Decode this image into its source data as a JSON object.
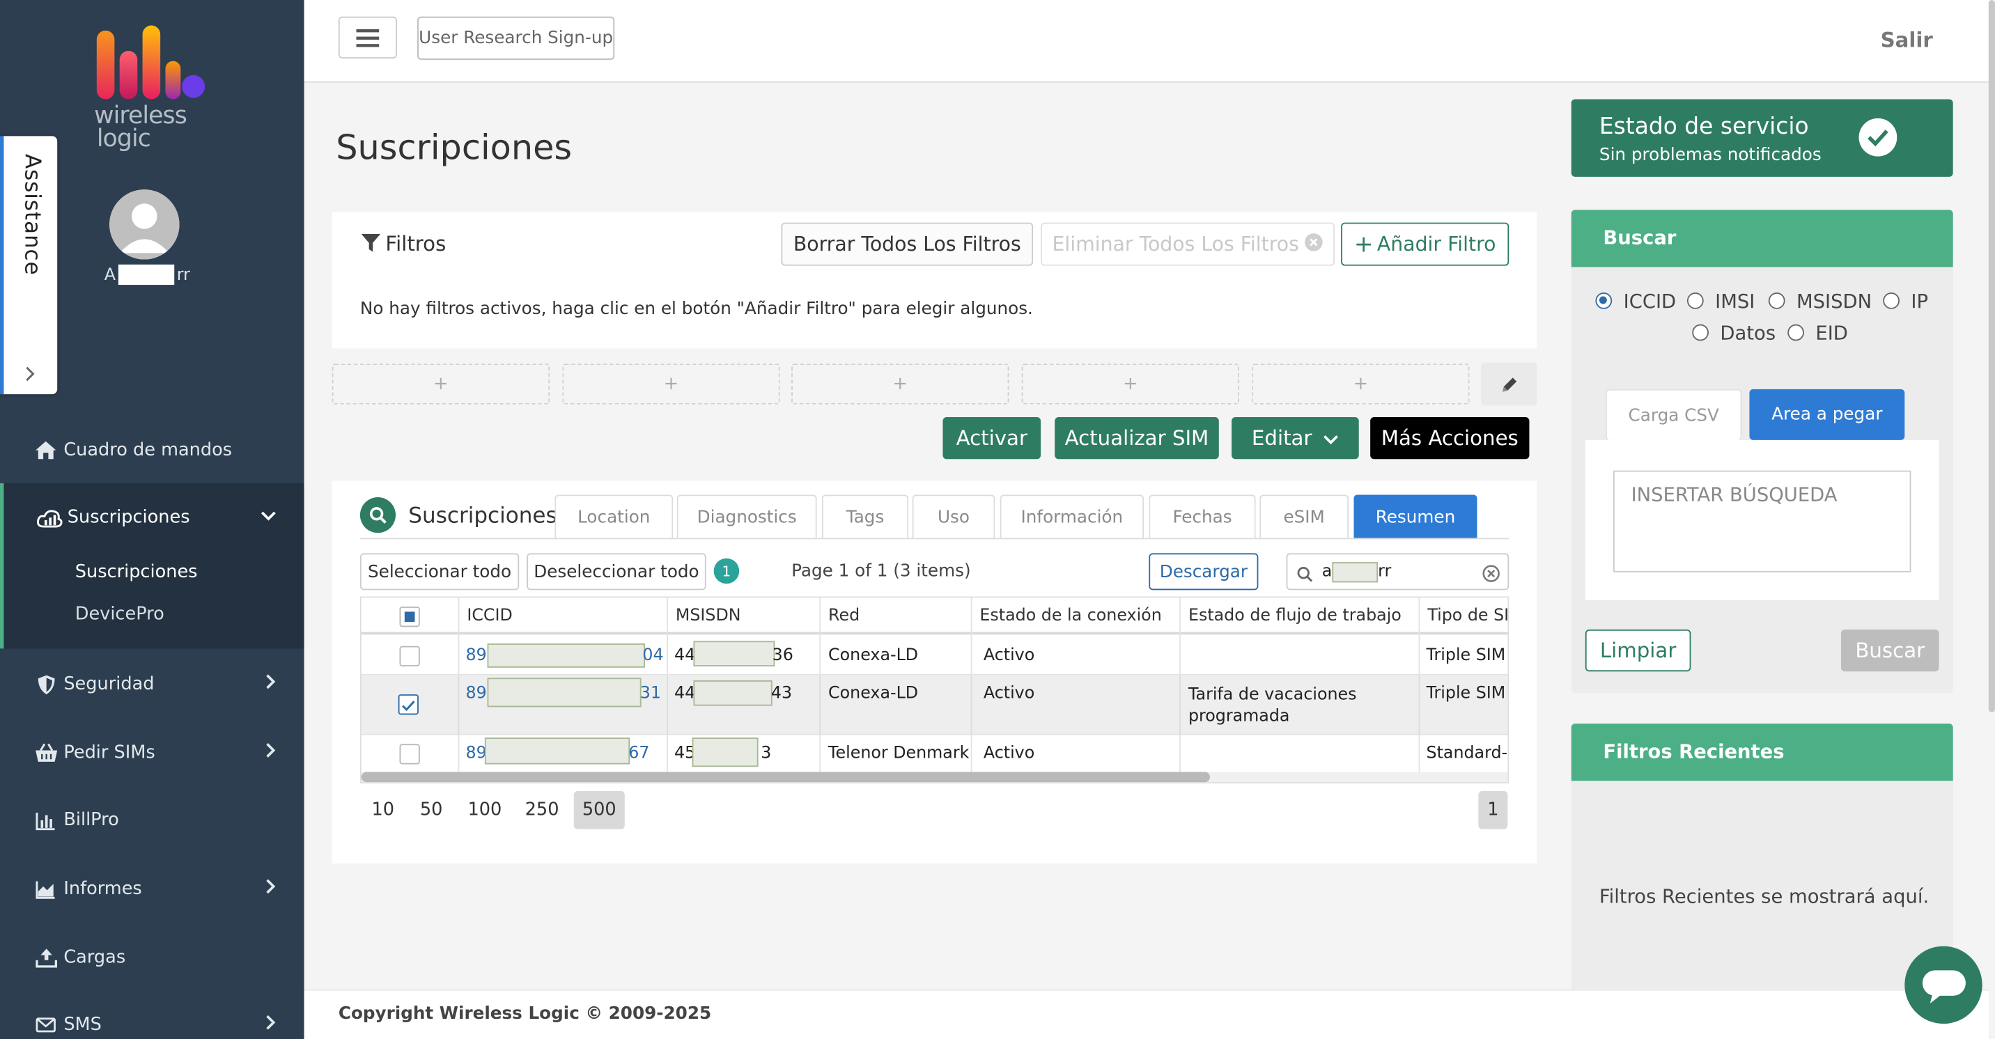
{
  "app": {
    "brand_line1": "wireless",
    "brand_line2": "logic",
    "user_name_start": "A",
    "user_name_end": "rr"
  },
  "assistance": {
    "label": "Assistance",
    "expand_icon": "chevron-right-icon"
  },
  "sidebar": {
    "items": [
      {
        "label": "Cuadro de mandos",
        "icon": "home-icon"
      },
      {
        "label": "Suscripciones",
        "icon": "cloud-signal-icon"
      },
      {
        "label": "Seguridad",
        "icon": "shield-icon"
      },
      {
        "label": "Pedir SIMs",
        "icon": "basket-icon"
      },
      {
        "label": "BillPro",
        "icon": "bar-chart-icon"
      },
      {
        "label": "Informes",
        "icon": "area-chart-icon"
      },
      {
        "label": "Cargas",
        "icon": "upload-icon"
      },
      {
        "label": "SMS",
        "icon": "envelope-icon"
      }
    ],
    "sub_items": [
      "Suscripciones",
      "DevicePro"
    ]
  },
  "topbar": {
    "research_label": "User Research Sign-up",
    "logout_label": "Salir"
  },
  "page": {
    "title": "Suscripciones"
  },
  "filters": {
    "title": "Filtros",
    "clear_all_label": "Borrar Todos Los Filtros",
    "remove_all_label": "Eliminar Todos Los Filtros",
    "add_label": "Añadir Filtro",
    "empty_message": "No hay filtros activos, haga clic en el botón \"Añadir Filtro\" para elegir algunos.",
    "slot_symbol": "+"
  },
  "actions": {
    "activate": "Activar",
    "update_sim": "Actualizar SIM",
    "edit": "Editar",
    "more": "Más Acciones"
  },
  "subscriptions": {
    "title": "Suscripciones",
    "tabs": [
      "Location",
      "Diagnostics",
      "Tags",
      "Uso",
      "Información",
      "Fechas",
      "eSIM",
      "Resumen"
    ],
    "active_tab": "Resumen",
    "select_all": "Seleccionar todo",
    "deselect_all": "Deseleccionar todo",
    "selected_count": "1",
    "page_info": "Page 1 of 1 (3 items)",
    "download": "Descargar",
    "search_value_start": "a",
    "search_value_end": "rr",
    "columns": [
      "ICCID",
      "MSISDN",
      "Red",
      "Estado de la conexión",
      "Estado de flujo de trabajo",
      "Tipo de SIM"
    ],
    "rows": [
      {
        "iccid_start": "894",
        "iccid_end": "04",
        "msisdn_start": "44",
        "msisdn_end": "36",
        "red": "Conexa-LD",
        "estado": "Activo",
        "flujo": "",
        "tipo": "Triple SIM",
        "checked": false
      },
      {
        "iccid_start": "894",
        "iccid_end": "31",
        "msisdn_start": "44",
        "msisdn_end": "43",
        "red": "Conexa-LD",
        "estado": "Activo",
        "flujo": "Tarifa de vacaciones programada",
        "tipo": "Triple SIM",
        "checked": true
      },
      {
        "iccid_start": "89",
        "iccid_end": "67",
        "msisdn_start": "45",
        "msisdn_end": "3",
        "red": "Telenor Denmark",
        "estado": "Activo",
        "flujo": "",
        "tipo": "Standard-S",
        "checked": false
      }
    ],
    "page_sizes": [
      "10",
      "50",
      "100",
      "250",
      "500"
    ],
    "active_page_size": "500",
    "current_page": "1"
  },
  "status": {
    "title": "Estado de servicio",
    "subtitle": "Sin problemas notificados"
  },
  "search": {
    "title": "Buscar",
    "options": [
      "ICCID",
      "IMSI",
      "MSISDN",
      "IP",
      "Datos",
      "EID"
    ],
    "selected": "ICCID",
    "tab_csv": "Carga CSV",
    "tab_paste": "Area a pegar",
    "placeholder": "INSERTAR BÚSQUEDA",
    "clear": "Limpiar",
    "submit": "Buscar"
  },
  "recent": {
    "title": "Filtros Recientes",
    "empty": "Filtros Recientes se mostrará aquí."
  },
  "footer": {
    "copyright": "Copyright Wireless Logic © 2009-2025"
  },
  "colors": {
    "sidebar": "#2c3e50",
    "green": "#2e7d62",
    "green_light": "#4caf86",
    "blue": "#2e7bd6",
    "black": "#000000"
  }
}
